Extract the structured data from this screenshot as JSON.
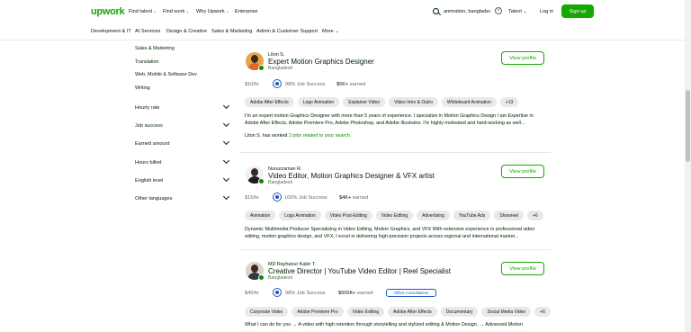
{
  "header": {
    "logo": "upwork",
    "nav": [
      "Find talent",
      "Find work",
      "Why Upwork",
      "Enterprise"
    ],
    "search_value": "animation, bangladesh",
    "search_scope": "Talent",
    "login": "Log in",
    "signup": "Sign up"
  },
  "categories": [
    "Development & IT",
    "AI Services",
    "Design & Creative",
    "Sales & Marketing",
    "Admin & Customer Support",
    "More"
  ],
  "sidebar": {
    "links": [
      "Sales & Marketing",
      "Translation",
      "Web, Mobile & Software Dev",
      "Writing"
    ],
    "filters": [
      "Hourly rate",
      "Job success",
      "Earned amount",
      "Hours billed",
      "English level",
      "Other languages"
    ]
  },
  "freelancers": [
    {
      "name": "Liton S.",
      "title": "Expert Motion Graphics Designer",
      "location": "Bangladesh",
      "rate": "$10/hr",
      "job_success": "98% Job Success",
      "earned_amount": "$5K+",
      "earned_label": "earned",
      "consult": "",
      "skills": [
        "Adobe After Effects",
        "Logo Animation",
        "Explainer Video",
        "Video Intro & Outro",
        "Whiteboard Animation",
        "+13"
      ],
      "desc": "I'm an expert motion Graphics Designer with more than 5 years of experience. I specialize in Motion Graphics Design I am Expertise in Adobe After Effects, Adobe Premiere Pro, Adobe Photoshop, and Adobe Illustrator. I'm highly motivated and hard-working as well...",
      "worked_prefix": "Liton S. has worked",
      "worked_link": "2 jobs related to your search."
    },
    {
      "name": "Nuruzzaman R.",
      "title": "Video Editor, Motion Graphics Designer & VFX artist",
      "location": "Bangladesh",
      "rate": "$15/hr",
      "job_success": "100% Job Success",
      "earned_amount": "$4K+",
      "earned_label": "earned",
      "consult": "",
      "skills": [
        "Animation",
        "Logo Animation",
        "Video Post-Editing",
        "Video Editing",
        "Advertising",
        "YouTube Ads",
        "Showreel",
        "+6"
      ],
      "desc": "Dynamic Multimedia Producer Specializing in Video Editing, Motion Graphics, and VFX With extensive experience in professional video editing, motion graphics design, and VFX, I excel in delivering high-precision projects across regional and international market...",
      "worked_prefix": "",
      "worked_link": ""
    },
    {
      "name": "MD Rayhanur Kabir T.",
      "title": "Creative Director | YouTube Video Editor | Reel Specialist",
      "location": "Bangladesh",
      "rate": "$40/hr",
      "job_success": "98% Job Success",
      "earned_amount": "$600K+",
      "earned_label": "earned",
      "consult": "Offers Consultations",
      "skills": [
        "Corporate Video",
        "Adobe Premiere Pro",
        "Video Editing",
        "Adobe After Effects",
        "Documentary",
        "Social Media Video",
        "+6"
      ],
      "desc": "What I can do for you → A video with high retention through storytelling and stylized editing & Motion Design. → Advanced Motion",
      "worked_prefix": "",
      "worked_link": ""
    }
  ],
  "view_profile": "View profile"
}
